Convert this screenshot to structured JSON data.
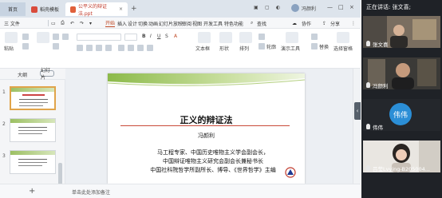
{
  "titlebar": {
    "home_tab": "首页",
    "template_tab": "稻壳模板",
    "doc_tab": "公平义的辩证法.ppt",
    "add_tab": "+",
    "user_name": "冯颜利",
    "window_controls": [
      "—",
      "□",
      "×"
    ]
  },
  "menubar": {
    "file_menu": "三 文件",
    "items": [
      "开始",
      "插入",
      "设计",
      "切换",
      "动画",
      "幻灯片放映",
      "审阅",
      "视图",
      "开发工具",
      "特色功能"
    ],
    "search": "查找",
    "collab": "协作",
    "share": "分享"
  },
  "ribbon": {
    "paste": "粘贴",
    "cut": "剪切",
    "format_painter": "格式刷",
    "new_slide": "新建幻灯片",
    "layout": "版式",
    "section": "节",
    "reset": "重置",
    "textbox": "文本框",
    "shape": "形状",
    "arrange": "排列",
    "outline": "轮廓",
    "slideshow": "演示工具",
    "replace": "替换",
    "select_pane": "选择窗格"
  },
  "panel": {
    "outline_tab": "大纲",
    "slides_tab": "幻灯片",
    "thumb_numbers": [
      "1",
      "2",
      "3"
    ]
  },
  "slide": {
    "title": "正义的辩证法",
    "author": "冯颜利",
    "lines": [
      "马工程专家、中国历史唯物主义学会副会长，",
      "中国辩证唯物主义研究会副会长兼秘书长",
      "中国社科院哲学所副所长、博导、《世界哲学》主编"
    ]
  },
  "notes": {
    "add": "+",
    "hint": "单击此处添加备注"
  },
  "meeting": {
    "speaking_label": "正在讲话: 张文喜;",
    "participants": [
      {
        "name": "张文喜",
        "type": "video"
      },
      {
        "name": "冯颜利",
        "type": "video"
      },
      {
        "name": "伟伟",
        "type": "avatar",
        "avatar_text": "伟伟"
      },
      {
        "name": "吕莹Lvying-B205004...",
        "type": "video"
      }
    ]
  },
  "colors": {
    "accent": "#c04a26",
    "slide_band_green": "#8cba4a",
    "meeting_bg": "#1f2227",
    "avatar_blue": "#2b8ed6"
  }
}
